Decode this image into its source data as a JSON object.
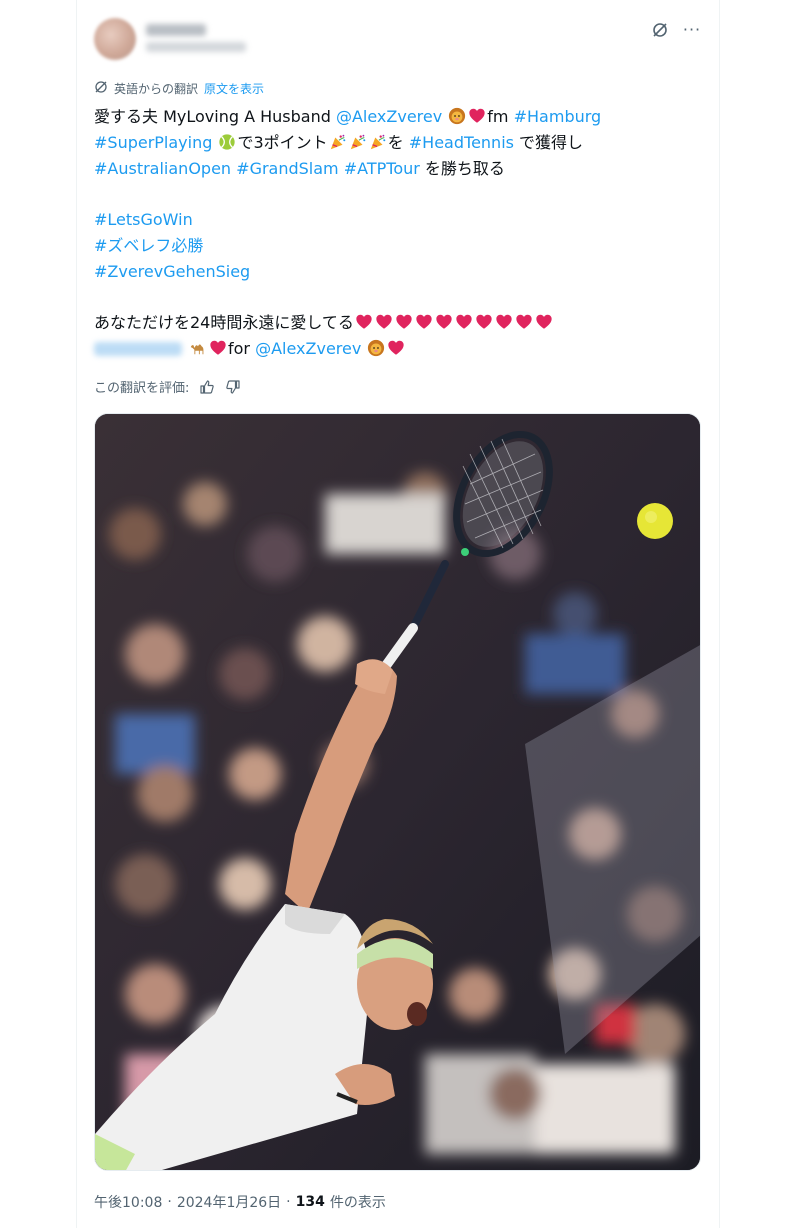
{
  "post": {
    "translation": {
      "label": "英語からの翻訳",
      "show_original": "原文を表示"
    },
    "lines": {
      "l1_text": "愛する夫 MyLoving A Husband ",
      "l1_mention": "@AlexZverev",
      "l1_fm": "fm ",
      "l1_tag": "#Hamburg",
      "l2_tag1": "#SuperPlaying",
      "l2_text1": "で3ポイント",
      "l2_text2": "を ",
      "l2_tag2": "#HeadTennis",
      "l2_text3": " で獲得し",
      "l3_tag1": "#AustralianOpen",
      "l3_tag2": "#GrandSlam",
      "l3_tag3": "#ATPTour",
      "l3_text": " を勝ち取る",
      "tag_letsgowin": "#LetsGoWin",
      "tag_zverev_jp": "#ズベレフ必勝",
      "tag_gehensieg": "#ZverevGehenSieg",
      "love_text": "あなただけを24時間永遠に愛してる",
      "last_for": "for ",
      "last_mention": "@AlexZverev"
    },
    "rate_label": "この翻訳を評価:",
    "media_alt": "tennis-player-serving-photo",
    "meta": {
      "time": "午後10:08",
      "sep1": "·",
      "date": "2024年1月26日",
      "sep2": "·",
      "views": "134",
      "views_label": "件の表示"
    }
  },
  "icons": {
    "translate": "translate-icon",
    "grok": "grok-icon",
    "more": "more-icon",
    "thumbs_up": "thumbs-up-icon",
    "thumbs_down": "thumbs-down-icon",
    "emoji_lion": "lion-emoji",
    "emoji_heart": "red-heart-emoji",
    "emoji_tennis": "tennis-ball-emoji",
    "emoji_party": "party-popper-emoji",
    "emoji_camel": "camel-emoji"
  },
  "colors": {
    "link": "#1d9bf0",
    "text": "#0f1419",
    "muted": "#536471",
    "heart": "#e0245e"
  }
}
